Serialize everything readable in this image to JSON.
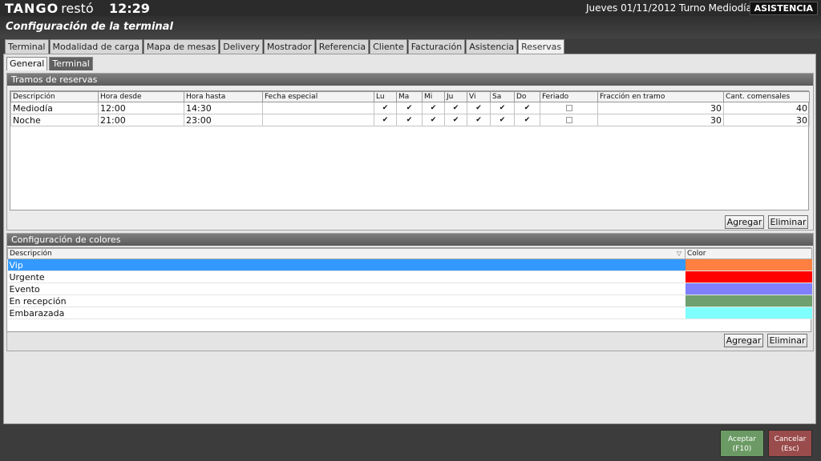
{
  "topbar": {
    "brand_main": "TANGO",
    "brand_sub": "restó",
    "clock": "12:29",
    "date_shift": "Jueves 01/11/2012 Turno Mediodía",
    "mode": "ASISTENCIA"
  },
  "page": {
    "title": "Configuración de la terminal"
  },
  "tabs": [
    {
      "label": "Terminal"
    },
    {
      "label": "Modalidad de carga"
    },
    {
      "label": "Mapa de mesas"
    },
    {
      "label": "Delivery"
    },
    {
      "label": "Mostrador"
    },
    {
      "label": "Referencia"
    },
    {
      "label": "Cliente"
    },
    {
      "label": "Facturación"
    },
    {
      "label": "Asistencia"
    },
    {
      "label": "Reservas"
    }
  ],
  "active_tab": "Reservas",
  "subtabs": [
    {
      "label": "General"
    },
    {
      "label": "Terminal"
    }
  ],
  "tramos": {
    "title": "Tramos de reservas",
    "headers": [
      "Descripción",
      "Hora desde",
      "Hora hasta",
      "Fecha especial",
      "Lu",
      "Ma",
      "Mi",
      "Ju",
      "Vi",
      "Sa",
      "Do",
      "Feriado",
      "Fracción en tramo",
      "Cant. comensales"
    ],
    "rows": [
      {
        "descripcion": "Mediodía",
        "desde": "12:00",
        "hasta": "14:30",
        "fecha": "",
        "fraccion": "30",
        "comensales": "40"
      },
      {
        "descripcion": "Noche",
        "desde": "21:00",
        "hasta": "23:00",
        "fecha": "",
        "fraccion": "30",
        "comensales": "30"
      }
    ],
    "check_mark": "✔",
    "add_label": "Agregar",
    "delete_label": "Eliminar"
  },
  "colores": {
    "title": "Configuración de colores",
    "headers": [
      "Descripción",
      "Color"
    ],
    "sort_glyph": "▽",
    "rows": [
      {
        "descripcion": "Vip",
        "color": "#ff8040"
      },
      {
        "descripcion": "Urgente",
        "color": "#ff0000"
      },
      {
        "descripcion": "Evento",
        "color": "#8080ff"
      },
      {
        "descripcion": "En recepción",
        "color": "#6f9f6f"
      },
      {
        "descripcion": "Embarazada",
        "color": "#80ffff"
      }
    ],
    "add_label": "Agregar",
    "delete_label": "Eliminar"
  },
  "footer": {
    "ok_label": "Aceptar",
    "ok_key": "(F10)",
    "cancel_label": "Cancelar",
    "cancel_key": "(Esc)"
  }
}
